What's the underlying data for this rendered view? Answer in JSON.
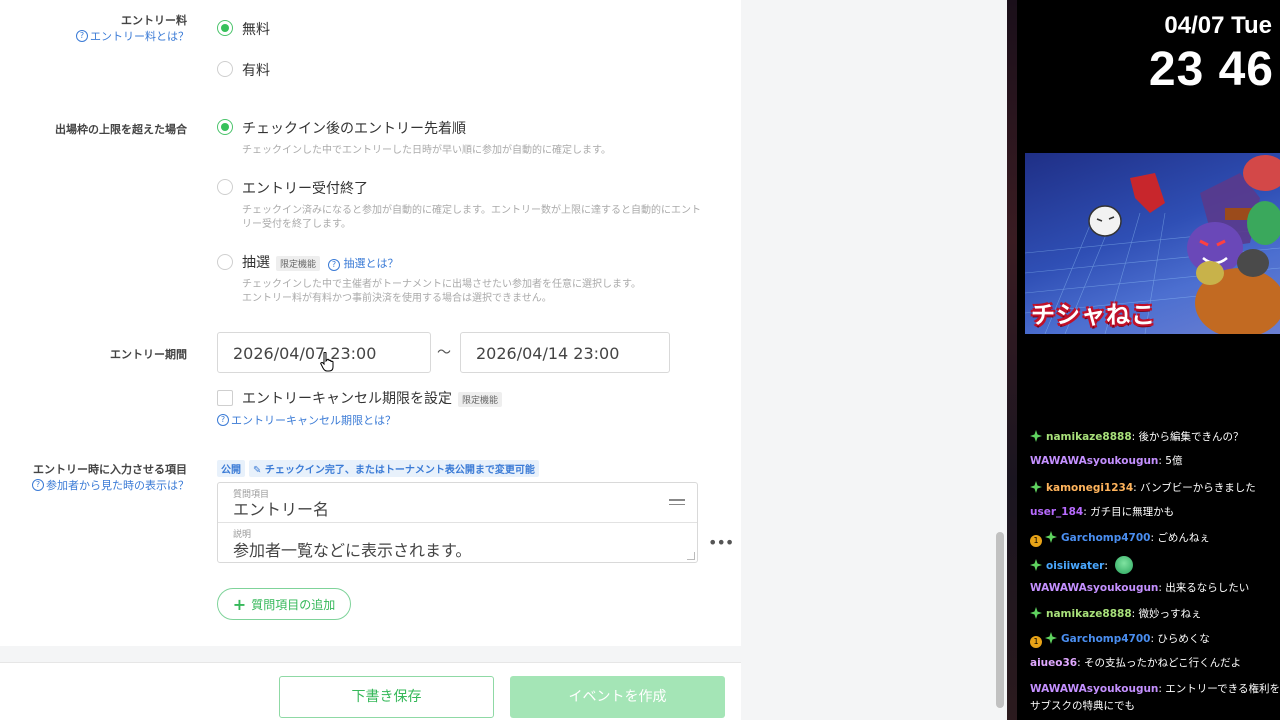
{
  "form": {
    "entry_fee": {
      "label": "エントリー料",
      "help": "エントリー料とは？",
      "options": [
        "無料",
        "有料"
      ],
      "selected": "無料"
    },
    "overflow": {
      "label": "出場枠の上限を超えた場合",
      "option1": "チェックイン後のエントリー先着順",
      "option1_desc": "チェックインした中でエントリーした日時が早い順に参加が自動的に確定します。",
      "option2": "エントリー受付終了",
      "option2_desc_line1": "チェックイン済みになると参加が自動的に確定します。エントリー数が上限に達すると自動的にエント",
      "option2_desc_line2": "リー受付を終了します。",
      "option3": "抽選",
      "option3_tag": "限定機能",
      "option3_help": "抽選とは？",
      "option3_desc_line1": "チェックインした中で主催者がトーナメントに出場させたい参加者を任意に選択します。",
      "option3_desc_line2": "エントリー料が有料かつ事前決済を使用する場合は選択できません。",
      "selected": "チェックイン後のエントリー先着順"
    },
    "entry_period": {
      "label": "エントリー期間",
      "start": "2026/04/07 23:00",
      "separator": "～",
      "end": "2026/04/14 23:00",
      "cancel_checkbox_label": "エントリーキャンセル期限を設定",
      "cancel_tag": "限定機能",
      "cancel_help": "エントリーキャンセル期限とは？"
    },
    "entry_items": {
      "label": "エントリー時に入力させる項目",
      "help": "参加者から見た時の表示は？",
      "pill_public": "公開",
      "pill_editable": "✎ チェックイン完了、またはトーナメント表公開まで変更可能",
      "question_small": "質問項目",
      "question_value": "エントリー名",
      "desc_small": "説明",
      "desc_value": "参加者一覧などに表示されます。",
      "add_button": "質問項目の追加"
    },
    "footer": {
      "draft_button": "下書き保存",
      "create_button": "イベントを作成"
    }
  },
  "overlay": {
    "date": "04/07 Tue",
    "time": "23 46",
    "art_logo": "チシャねこ",
    "chat": [
      {
        "badges": [
          "green"
        ],
        "user": "namikaze8888",
        "color": "#a8e07a",
        "text": "後から編集できんの？"
      },
      {
        "badges": [],
        "user": "WAWAWAsyoukougun",
        "color": "#c490ff",
        "text": "5億"
      },
      {
        "badges": [
          "green"
        ],
        "user": "kamonegi1234",
        "color": "#ffb45c",
        "text": "バンブビーからきました"
      },
      {
        "badges": [],
        "user": "user_184",
        "color": "#b86bff",
        "text": "ガチ目に無理かも"
      },
      {
        "badges": [
          "gold",
          "green"
        ],
        "user": "Garchomp4700",
        "color": "#4a8ef0",
        "text": "ごめんねぇ"
      },
      {
        "badges": [
          "green"
        ],
        "user": "oisiiwater",
        "color": "#4aa8ff",
        "text": "",
        "emote": true
      },
      {
        "badges": [],
        "user": "WAWAWAsyoukougun",
        "color": "#c490ff",
        "text": "出来るならしたい"
      },
      {
        "badges": [
          "green"
        ],
        "user": "namikaze8888",
        "color": "#a8e07a",
        "text": "微妙っすねぇ"
      },
      {
        "badges": [
          "gold",
          "green"
        ],
        "user": "Garchomp4700",
        "color": "#4a8ef0",
        "text": "ひらめくな"
      },
      {
        "badges": [],
        "user": "aiueo36",
        "color": "#e0a8ff",
        "text": "その支払ったかねどこ行くんだよ"
      },
      {
        "badges": [],
        "user": "WAWAWAsyoukougun",
        "color": "#c490ff",
        "text": "エントリーできる権利を"
      },
      {
        "badges": [],
        "user": "",
        "color": "#ffffff",
        "text": "サブスクの特典にでも"
      }
    ]
  },
  "colors": {
    "accent_green": "#36c15a",
    "link_blue": "#3b7bd6"
  }
}
